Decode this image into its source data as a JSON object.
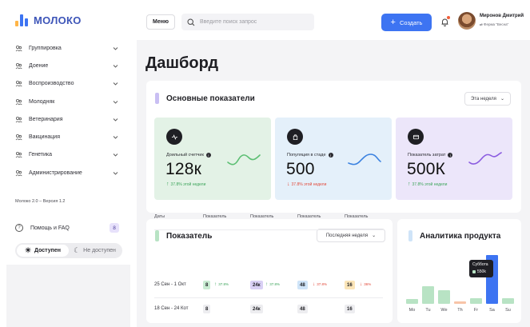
{
  "app": {
    "name": "МОЛОКО",
    "version": "Молоко 2.0 – Версия 1.2"
  },
  "sidebar": {
    "items": [
      {
        "label": "Группировка",
        "icon": "cluster-icon"
      },
      {
        "label": "Доение",
        "icon": "cluster-icon"
      },
      {
        "label": "Воспроизводство",
        "icon": "cluster-icon"
      },
      {
        "label": "Молодняк",
        "icon": "cluster-icon"
      },
      {
        "label": "Ветеринария",
        "icon": "cluster-icon"
      },
      {
        "label": "Вакцинация",
        "icon": "cluster-icon"
      },
      {
        "label": "Генетика",
        "icon": "cluster-icon"
      },
      {
        "label": "Администрирование",
        "icon": "cluster-icon"
      }
    ],
    "help": {
      "label": "Помощь и FAQ",
      "badge": "8"
    },
    "status": {
      "available": "Доступен",
      "unavailable": "Не доступен",
      "selected": "Доступен"
    }
  },
  "header": {
    "menu_label": "Меню",
    "search_placeholder": "Введите поиск запрос",
    "create_label": "Создать",
    "user_name": "Миронов Дмитрий",
    "user_farm": "Ферма \"Весна\""
  },
  "dashboard": {
    "title": "Дашборд",
    "kpi_section": {
      "title": "Основные показатели",
      "period": "Эта неделя",
      "cards": [
        {
          "label": "Доильный счетчик",
          "value": "128к",
          "delta": "37.8% этой недели",
          "trend": "up",
          "bg": "#e3f2e6",
          "spark": "#5cbf73"
        },
        {
          "label": "Популяция в стаде",
          "value": "500",
          "delta": "37.8% этой недели",
          "trend": "down",
          "bg": "#e4f0fa",
          "spark": "#3b82e0"
        },
        {
          "label": "Показатель затрат",
          "value": "500К",
          "delta": "37.8% этой недели",
          "trend": "up",
          "bg": "#ece6fa",
          "spark": "#8b5ce0"
        }
      ]
    },
    "table_section": {
      "title": "Показатель",
      "period": "Последняя неделя",
      "columns": [
        "Даты",
        "Показатель",
        "Показатель",
        "Показатель",
        "Показатель"
      ],
      "rows": [
        {
          "date": "25 Сен - 1 Окт",
          "cells": [
            {
              "value": "8",
              "delta": "37.8%",
              "trend": "up",
              "bg": "#c9ecd2"
            },
            {
              "value": "24к",
              "delta": "37.8%",
              "trend": "up",
              "bg": "#d9d0f5"
            },
            {
              "value": "48",
              "delta": "37.8%",
              "trend": "down",
              "bg": "#cfe4f8"
            },
            {
              "value": "16",
              "delta": "36%",
              "trend": "down",
              "bg": "#fbe5b8"
            }
          ]
        },
        {
          "date": "18 Сен - 24 Кот",
          "cells": [
            {
              "value": "8"
            },
            {
              "value": "24к"
            },
            {
              "value": "48"
            },
            {
              "value": "16"
            }
          ]
        }
      ]
    },
    "analytics_section": {
      "title": "Аналитика продукта",
      "tooltip": {
        "label": "Суббота",
        "value": "550k"
      }
    }
  },
  "chart_data": {
    "type": "bar",
    "categories": [
      "Mo",
      "Tu",
      "We",
      "Th",
      "Fr",
      "Sa",
      "Su"
    ],
    "values": [
      9,
      33,
      25,
      5,
      10,
      92,
      10
    ],
    "colors": [
      "#b8e3c4",
      "#b8e3c4",
      "#b8e3c4",
      "#f8c4a8",
      "#b8e3c4",
      "#3d74f2",
      "#b8e3c4"
    ],
    "highlight": "Sa",
    "ylim": [
      0,
      100
    ]
  },
  "colors": {
    "accent": "#3d74f2",
    "up": "#3ca45a",
    "down": "#e2493a"
  }
}
